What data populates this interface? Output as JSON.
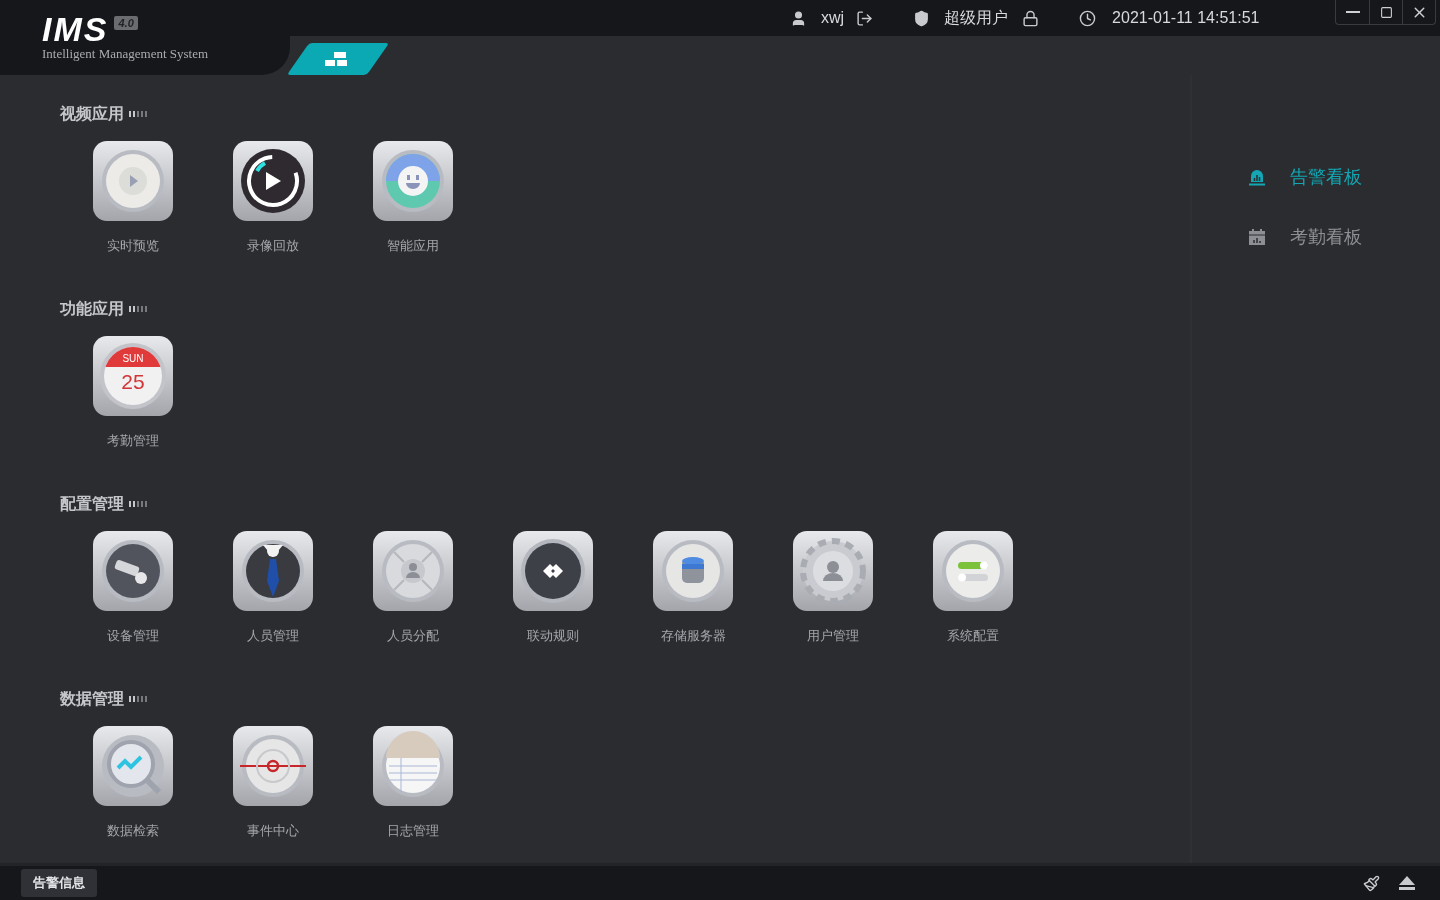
{
  "logo": {
    "name": "IMS",
    "version": "4.0",
    "subtitle": "Intelligent Management System"
  },
  "header": {
    "user": "xwj",
    "role": "超级用户",
    "datetime": "2021-01-11 14:51:51"
  },
  "sections": [
    {
      "title": "视频应用",
      "apps": [
        {
          "label": "实时预览",
          "kind": "play"
        },
        {
          "label": "录像回放",
          "kind": "record"
        },
        {
          "label": "智能应用",
          "kind": "smile"
        }
      ]
    },
    {
      "title": "功能应用",
      "apps": [
        {
          "label": "考勤管理",
          "kind": "calendar",
          "day": "SUN",
          "date": "25"
        }
      ]
    },
    {
      "title": "配置管理",
      "apps": [
        {
          "label": "设备管理",
          "kind": "camera"
        },
        {
          "label": "人员管理",
          "kind": "suit"
        },
        {
          "label": "人员分配",
          "kind": "dpad"
        },
        {
          "label": "联动规则",
          "kind": "link"
        },
        {
          "label": "存储服务器",
          "kind": "database"
        },
        {
          "label": "用户管理",
          "kind": "gear"
        },
        {
          "label": "系统配置",
          "kind": "toggles"
        }
      ]
    },
    {
      "title": "数据管理",
      "apps": [
        {
          "label": "数据检索",
          "kind": "search"
        },
        {
          "label": "事件中心",
          "kind": "alarm"
        },
        {
          "label": "日志管理",
          "kind": "notes"
        }
      ]
    }
  ],
  "dashboards": [
    {
      "label": "告警看板",
      "kind": "alarm",
      "selected": true
    },
    {
      "label": "考勤看板",
      "kind": "calendar",
      "selected": false
    }
  ],
  "footer": {
    "alert_button": "告警信息"
  }
}
